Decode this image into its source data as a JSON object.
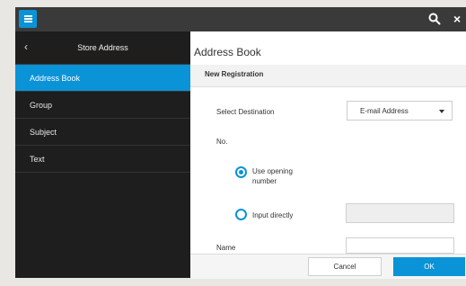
{
  "header": {
    "menu_icon": "hamburger-menu-icon",
    "search_icon": "search-icon",
    "close_icon": "close-icon",
    "close_glyph": "×"
  },
  "sidebar": {
    "back_glyph": "‹",
    "title": "Store Address",
    "items": [
      {
        "label": "Address Book",
        "active": true
      },
      {
        "label": "Group"
      },
      {
        "label": "Subject"
      },
      {
        "label": "Text"
      }
    ]
  },
  "main": {
    "title": "Address Book",
    "section": "New Registration",
    "select_destination_label": "Select Destination",
    "select_destination_value": "E-mail Address",
    "no_label": "No.",
    "radio_use_opening": "Use opening number",
    "radio_input_directly": "Input directly",
    "name_label": "Name"
  },
  "footer": {
    "cancel": "Cancel",
    "ok": "OK"
  },
  "colors": {
    "accent": "#0a93d6",
    "topbar": "#3a3a3a",
    "sidebar": "#1e1e1e"
  }
}
